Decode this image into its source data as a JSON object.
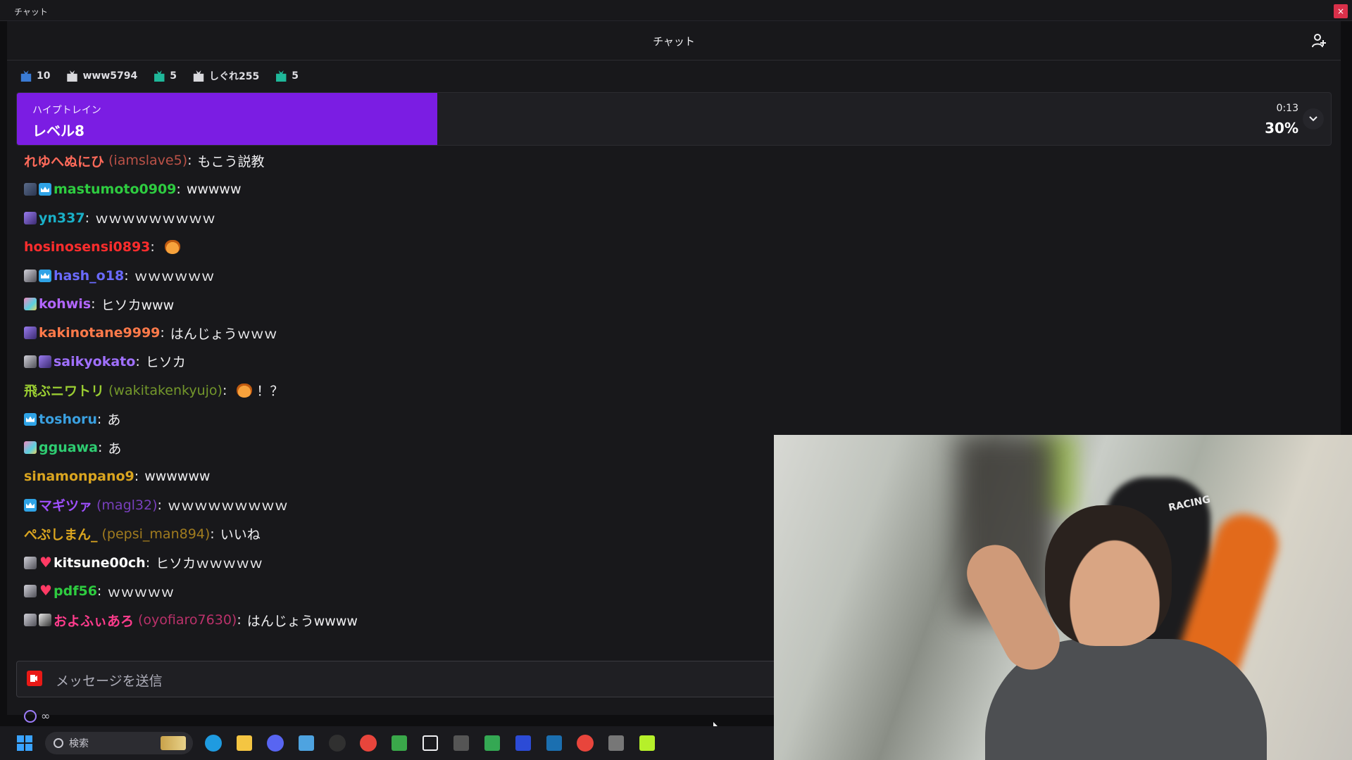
{
  "window": {
    "title": "チャット",
    "close_glyph": "×"
  },
  "chat": {
    "header_title": "チャット"
  },
  "gifts": [
    {
      "icon": "gift-icon-blue",
      "label": "10"
    },
    {
      "icon": "gift-box-icon",
      "label": "www5794"
    },
    {
      "icon": "gift-icon-teal",
      "label": "5"
    },
    {
      "icon": "gift-box-icon",
      "label": "しぐれ255"
    },
    {
      "icon": "gift-icon-teal",
      "label": "5"
    }
  ],
  "hype_train": {
    "label": "ハイプトレイン",
    "level": "レベル8",
    "time": "0:13",
    "percent": "30%",
    "progress": 0.3,
    "accent": "#7b1de3"
  },
  "messages": [
    {
      "badges": [],
      "name": "れゆへぬにひ",
      "login": "(iamslave5)",
      "color": "#ff6a5a",
      "text": "もこう説教"
    },
    {
      "badges": [
        "b-sub",
        "b-prime"
      ],
      "name": "mastumoto0909",
      "color": "#2ecc40",
      "text": "wwwww"
    },
    {
      "badges": [
        "b-gift"
      ],
      "name": "yn337",
      "color": "#1ab0c8",
      "text": "ｗｗｗｗｗｗｗｗｗ"
    },
    {
      "badges": [],
      "name": "hosinosensi0893",
      "color": "#ff2d2d",
      "text": "",
      "emote": "fox-emote"
    },
    {
      "badges": [
        "b-ava",
        "b-prime"
      ],
      "name": "hash_o18",
      "color": "#6a6aff",
      "text": "ｗｗｗｗｗｗ"
    },
    {
      "badges": [
        "b-art"
      ],
      "name": "kohwis",
      "color": "#b266ff",
      "text": "ヒソカwww"
    },
    {
      "badges": [
        "b-gift"
      ],
      "name": "kakinotane9999",
      "color": "#ff7a4a",
      "text": "はんじょうｗｗｗ"
    },
    {
      "badges": [
        "b-ava",
        "b-gift"
      ],
      "name": "saikyokato",
      "color": "#a070ff",
      "text": "ヒソカ"
    },
    {
      "badges": [],
      "name": "飛ぶニワトリ",
      "login": "(wakitakenkyujo)",
      "color": "#9acd32",
      "text": "！？",
      "emote": "fox-emote"
    },
    {
      "badges": [
        "b-prime"
      ],
      "name": "toshoru",
      "color": "#3aa0e0",
      "text": "あ"
    },
    {
      "badges": [
        "b-art"
      ],
      "name": "gguawa",
      "color": "#2ecc71",
      "text": "あ"
    },
    {
      "badges": [],
      "name": "sinamonpano9",
      "color": "#daa520",
      "text": "wwwwww"
    },
    {
      "badges": [
        "b-prime"
      ],
      "name": "マギツァ",
      "login": "(magl32)",
      "color": "#a050ff",
      "text": "ｗｗｗｗｗｗｗｗｗ"
    },
    {
      "badges": [],
      "name": "ぺぷしまん_",
      "login": "(pepsi_man894)",
      "color": "#daa520",
      "text": "いいね"
    },
    {
      "badges": [
        "b-ava",
        "b-heart"
      ],
      "name": "kitsune00ch",
      "color": "#ffffff",
      "text": "ヒソカｗｗｗｗｗ"
    },
    {
      "badges": [
        "b-ava",
        "b-heart"
      ],
      "name": "pdf56",
      "color": "#2ecc40",
      "text": "ｗｗｗｗｗ"
    },
    {
      "badges": [
        "b-ava",
        "b-bw"
      ],
      "name": "およふぃあろ",
      "login": "(oyofiaro7630)",
      "color": "#ff3c8c",
      "text": "はんじょうwwww"
    }
  ],
  "input": {
    "placeholder": "メッセージを送信"
  },
  "points": {
    "value": "∞"
  },
  "webcam": {
    "chair_text": "RACING"
  },
  "taskbar": {
    "search_label": "検索",
    "apps": [
      "edge-icon",
      "folder-icon",
      "discord-icon",
      "notepad-icon",
      "obs-icon",
      "chrome-icon",
      "minecraft-icon",
      "x-icon",
      "keyboard-icon",
      "drive-icon",
      "monitor-icon",
      "steam-icon",
      "chrome-icon",
      "unc-icon",
      "play-icon"
    ]
  }
}
